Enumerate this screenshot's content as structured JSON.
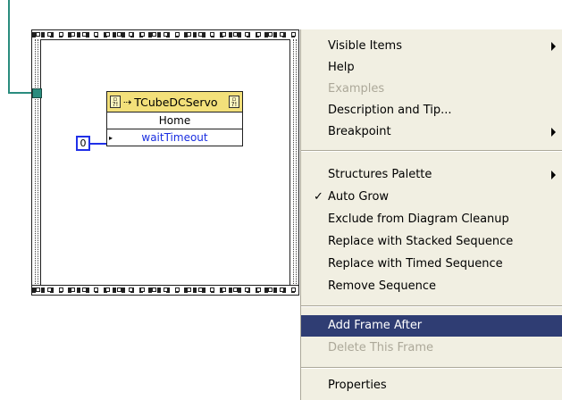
{
  "diagram": {
    "property_node": {
      "class_name": "TCubeDCServo",
      "method": "Home",
      "parameter": "waitTimeout"
    },
    "constant_value": "0"
  },
  "context_menu": {
    "items": [
      {
        "label": "Visible Items",
        "submenu": true,
        "state": "normal"
      },
      {
        "label": "Help",
        "submenu": false,
        "state": "normal"
      },
      {
        "label": "Examples",
        "submenu": false,
        "state": "disabled"
      },
      {
        "label": "Description and Tip...",
        "submenu": false,
        "state": "normal"
      },
      {
        "label": "Breakpoint",
        "submenu": true,
        "state": "normal"
      },
      {
        "label": "Structures Palette",
        "submenu": true,
        "state": "normal"
      },
      {
        "label": "Auto Grow",
        "submenu": false,
        "state": "checked"
      },
      {
        "label": "Exclude from Diagram Cleanup",
        "submenu": false,
        "state": "normal"
      },
      {
        "label": "Replace with Stacked Sequence",
        "submenu": false,
        "state": "normal"
      },
      {
        "label": "Replace with Timed Sequence",
        "submenu": false,
        "state": "normal"
      },
      {
        "label": "Remove Sequence",
        "submenu": false,
        "state": "normal"
      },
      {
        "label": "Add Frame After",
        "submenu": false,
        "state": "highlighted"
      },
      {
        "label": "Delete This Frame",
        "submenu": false,
        "state": "disabled"
      },
      {
        "label": "Properties",
        "submenu": false,
        "state": "normal"
      }
    ],
    "check_glyph": "✓"
  },
  "colors": {
    "wire": "#2a8c7e",
    "constant_border": "#2030e8",
    "menu_bg": "#f1efe2",
    "highlight": "#2f3d73",
    "disabled_text": "#aca899"
  }
}
